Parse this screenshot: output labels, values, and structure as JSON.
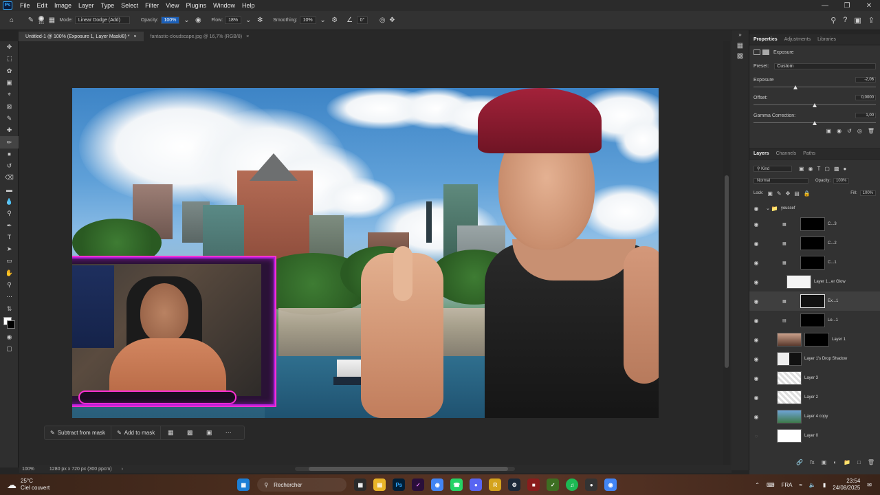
{
  "app": {
    "logo": "Ps"
  },
  "menu": {
    "items": [
      "File",
      "Edit",
      "Image",
      "Layer",
      "Type",
      "Select",
      "Filter",
      "View",
      "Plugins",
      "Window",
      "Help"
    ]
  },
  "options": {
    "brush_size": "161",
    "mode_label": "Mode:",
    "mode_value": "Linear Dodge (Add)",
    "opacity_label": "Opacity:",
    "opacity_value": "100%",
    "flow_label": "Flow:",
    "flow_value": "18%",
    "smoothing_label": "Smoothing:",
    "smoothing_value": "10%",
    "angle_value": "0°"
  },
  "tabs": [
    {
      "label": "Untitled-1 @ 100% (Exposure 1, Layer Mask/8) *"
    },
    {
      "label": "fantastic-cloudscape.jpg @ 16,7% (RGB/8)"
    }
  ],
  "maskbar": {
    "subtract": "Subtract from mask",
    "add": "Add to mask"
  },
  "status": {
    "zoom": "100%",
    "doc_info": "1280 px x 720 px (300 ppcm)"
  },
  "properties": {
    "tabs": [
      "Properties",
      "Adjustments",
      "Libraries"
    ],
    "adjustment_name": "Exposure",
    "preset_label": "Preset:",
    "preset_value": "Custom",
    "exposure_label": "Exposure",
    "exposure_value": "-2,06",
    "exposure_level": 0.34,
    "offset_label": "Offset:",
    "offset_value": "0,0000",
    "offset_level": 0.5,
    "gamma_label": "Gamma Correction:",
    "gamma_value": "1,00",
    "gamma_level": 0.5
  },
  "layers": {
    "tabs": [
      "Layers",
      "Channels",
      "Paths"
    ],
    "filter_label": "Kind",
    "blend_mode": "Normal",
    "opacity_label": "Opacity:",
    "opacity_value": "100%",
    "lock_label": "Lock:",
    "fill_label": "Fill:",
    "fill_value": "100%",
    "group_name": "youssef",
    "rows": [
      {
        "name": "C...3"
      },
      {
        "name": "C...2"
      },
      {
        "name": "C...1"
      },
      {
        "name": "Layer 1...er Glow"
      },
      {
        "name": "Ex...1"
      },
      {
        "name": "Le...1"
      },
      {
        "name": "Layer 1"
      },
      {
        "name": "Layer 1's Drop Shadow"
      },
      {
        "name": "Layer 3"
      },
      {
        "name": "Layer 2"
      },
      {
        "name": "Layer 4 copy"
      },
      {
        "name": "Layer 0"
      }
    ]
  },
  "taskbar": {
    "weather_temp": "25°C",
    "weather_desc": "Ciel couvert",
    "search_label": "Rechercher",
    "lang": "FRA",
    "time": "23:54",
    "date": "24/08/2025"
  },
  "colors": {
    "accent": "#31a8ff",
    "frame_purple": "#b01fd8",
    "frame_pink": "#ff2fd2"
  }
}
